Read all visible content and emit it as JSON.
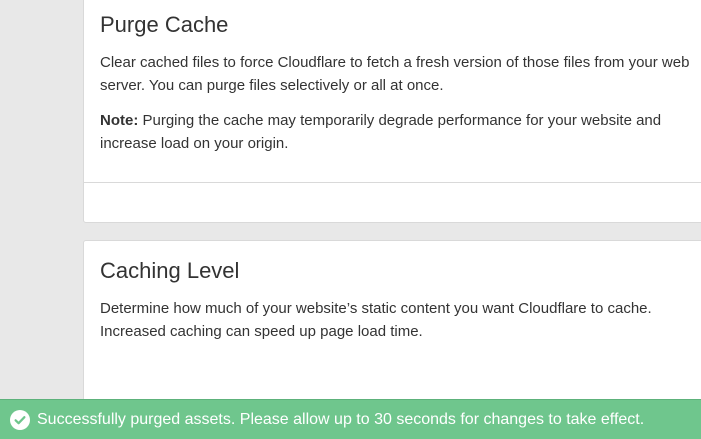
{
  "purge_cache": {
    "title": "Purge Cache",
    "description": "Clear cached files to force Cloudflare to fetch a fresh version of those files from your web server. You can purge files selectively or all at once.",
    "note_label": "Note:",
    "note_text": " Purging the cache may temporarily degrade performance for your website and increase load on your origin."
  },
  "caching_level": {
    "title": "Caching Level",
    "description": "Determine how much of your website’s static content you want Cloudflare to cache. Increased caching can speed up page load time."
  },
  "toast": {
    "icon": "check-circle-icon",
    "message": "Successfully purged assets. Please allow up to 30 seconds for changes to take effect.",
    "color": "#6fc68d"
  }
}
